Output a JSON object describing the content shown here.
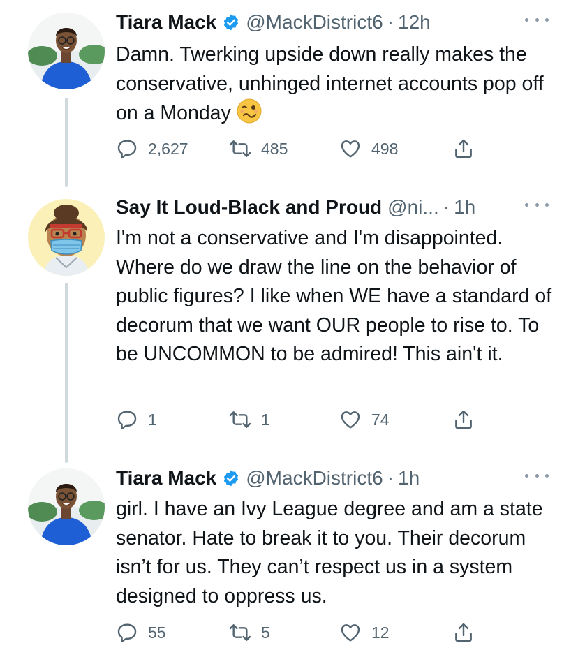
{
  "tweets": [
    {
      "name": "Tiara Mack",
      "verified": true,
      "handle": "@MackDistrict6",
      "dot": "·",
      "time": "12h",
      "text": "Damn. Twerking upside down really makes the conservative, unhinged internet accounts pop off on a Monday",
      "emoji": "woozy-face-icon",
      "replies": "2,627",
      "retweets": "485",
      "likes": "498"
    },
    {
      "name": "Say It Loud-Black and Proud",
      "verified": false,
      "handle": "@ni...",
      "dot": "·",
      "time": "1h",
      "text": "I'm not a conservative and I'm disappointed.  Where do we draw the line on the behavior of public figures?  I like when WE have a standard of decorum that we want OUR people to rise to. To be UNCOMMON to be admired!  This ain't it.",
      "replies": "1",
      "retweets": "1",
      "likes": "74"
    },
    {
      "name": "Tiara Mack",
      "verified": true,
      "handle": "@MackDistrict6",
      "dot": "·",
      "time": "1h",
      "text": "girl. I have an Ivy League degree and am a state senator. Hate to break it to you. Their decorum isn’t for us. They can’t respect us in a system designed to oppress us.",
      "replies": "55",
      "retweets": "5",
      "likes": "12"
    }
  ],
  "colors": {
    "text": "#0f1419",
    "secondary": "#536471",
    "verified": "#1d9bf0",
    "thread_line": "#cfd9de"
  }
}
